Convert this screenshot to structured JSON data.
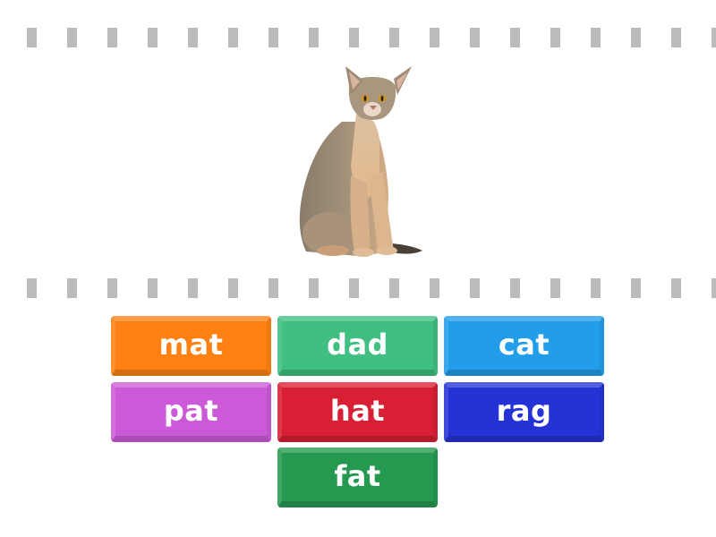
{
  "activity": {
    "type": "find-the-match",
    "picture": {
      "subject": "cat",
      "icon": "cat-photo"
    },
    "tiles": [
      {
        "label": "mat",
        "color": "#ff8114"
      },
      {
        "label": "dad",
        "color": "#3fbf81"
      },
      {
        "label": "cat",
        "color": "#229de9"
      },
      {
        "label": "pat",
        "color": "#cc5ad8"
      },
      {
        "label": "hat",
        "color": "#d81f33"
      },
      {
        "label": "rag",
        "color": "#2532d5"
      },
      {
        "label": "fat",
        "color": "#24994f"
      }
    ]
  }
}
